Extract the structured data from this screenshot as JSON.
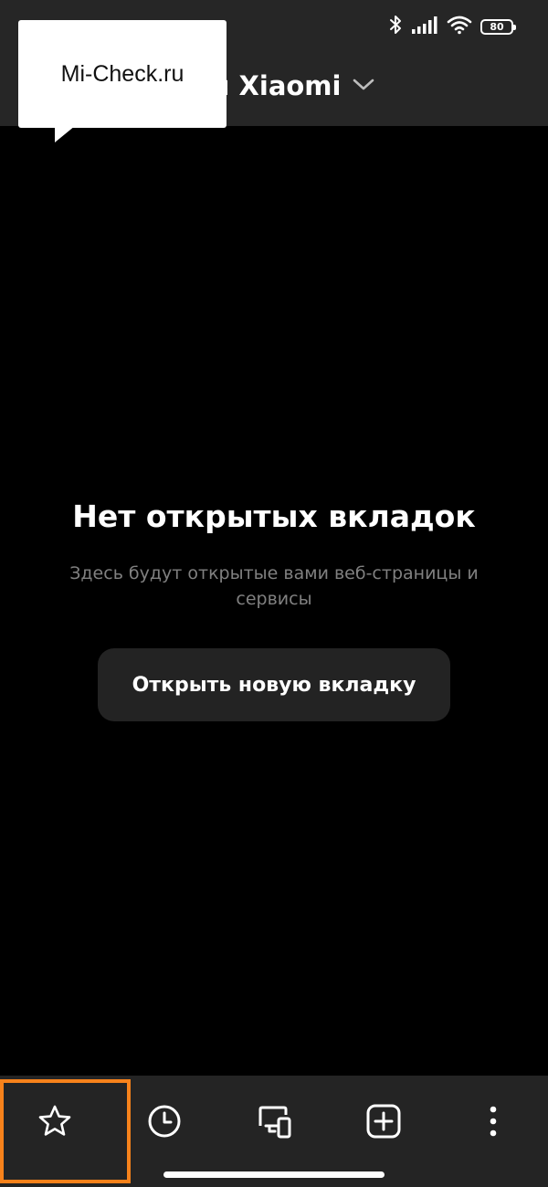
{
  "status_bar": {
    "battery_level": "80",
    "icons": [
      "bluetooth-icon",
      "signal-icon",
      "wifi-icon",
      "battery-icon"
    ]
  },
  "header": {
    "title_visible": "дки Xiaomi",
    "dropdown_icon": "chevron-down-icon"
  },
  "watermark": {
    "text": "Mi-Check.ru"
  },
  "empty_state": {
    "title": "Нет открытых вкладок",
    "description": "Здесь будут открытые вами веб-страницы и сервисы",
    "button_label": "Открыть новую вкладку"
  },
  "toolbar": {
    "items": [
      "star-icon",
      "history-icon",
      "devices-icon",
      "new-tab-icon",
      "more-icon"
    ],
    "highlight_color": "#f7821b"
  },
  "colors": {
    "background": "#000000",
    "bars": "#262626",
    "button": "#232323",
    "muted_text": "#808080"
  }
}
